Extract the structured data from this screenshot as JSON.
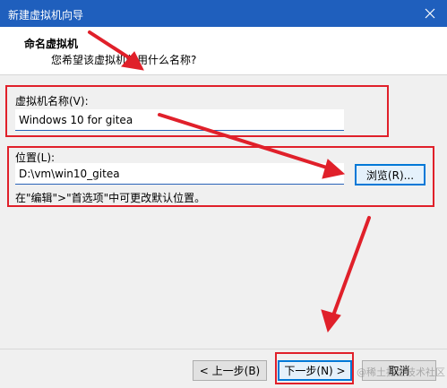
{
  "window": {
    "title": "新建虚拟机向导"
  },
  "header": {
    "title": "命名虚拟机",
    "subtitle": "您希望该虚拟机使用什么名称?"
  },
  "name_field": {
    "label": "虚拟机名称(V):",
    "value": "Windows 10 for gitea"
  },
  "location_field": {
    "label": "位置(L):",
    "value": "D:\\vm\\win10_gitea",
    "browse_label": "浏览(R)..."
  },
  "hint": "在\"编辑\">\"首选项\"中可更改默认位置。",
  "footer": {
    "back_label": "< 上一步(B)",
    "next_label": "下一步(N) >",
    "cancel_label": "取消"
  },
  "watermark": "@稀土掘金技术社区",
  "colors": {
    "titlebar": "#1f5fbd",
    "annotation_red": "#e0202a",
    "focus_blue": "#0078d7"
  },
  "icons": [
    "close-icon"
  ]
}
